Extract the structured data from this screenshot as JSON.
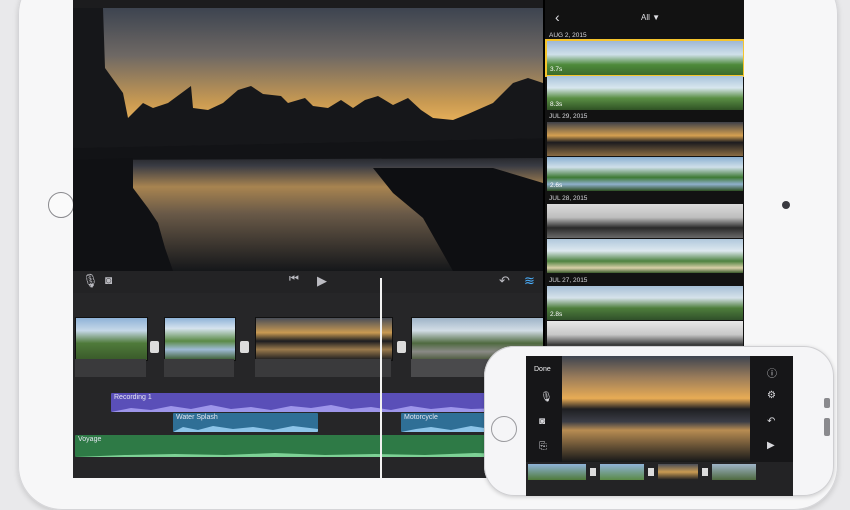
{
  "browser": {
    "filter_label": "All",
    "sections": [
      {
        "date": "AUG 2, 2015",
        "clips": [
          {
            "duration": "3.7s"
          },
          {
            "duration": "8.3s"
          }
        ]
      },
      {
        "date": "JUL 29, 2015",
        "clips": [
          {
            "duration": ""
          },
          {
            "duration": "2.6s"
          }
        ]
      },
      {
        "date": "JUL 28, 2015",
        "clips": [
          {
            "duration": ""
          },
          {
            "duration": ""
          }
        ]
      },
      {
        "date": "JUL 27, 2015",
        "clips": [
          {
            "duration": "2.8s"
          },
          {
            "duration": ""
          }
        ]
      }
    ]
  },
  "timeline": {
    "audio_tracks": [
      {
        "name": "Recording 1",
        "color": "#5a4fb8"
      },
      {
        "name": "Water Splash",
        "color": "#2f6f96"
      },
      {
        "name": "Motorcycle",
        "color": "#2f6f96"
      },
      {
        "name": "Voyage",
        "color": "#2e7a46"
      }
    ]
  },
  "iphone": {
    "done_label": "Done"
  },
  "icons": [
    "microphone-icon",
    "camera-icon",
    "skip-back-icon",
    "play-icon",
    "undo-icon",
    "audio-waveform-icon",
    "back-chevron-icon",
    "filter-triangle-icon",
    "help-icon",
    "settings-icon",
    "voiceover-icon"
  ]
}
